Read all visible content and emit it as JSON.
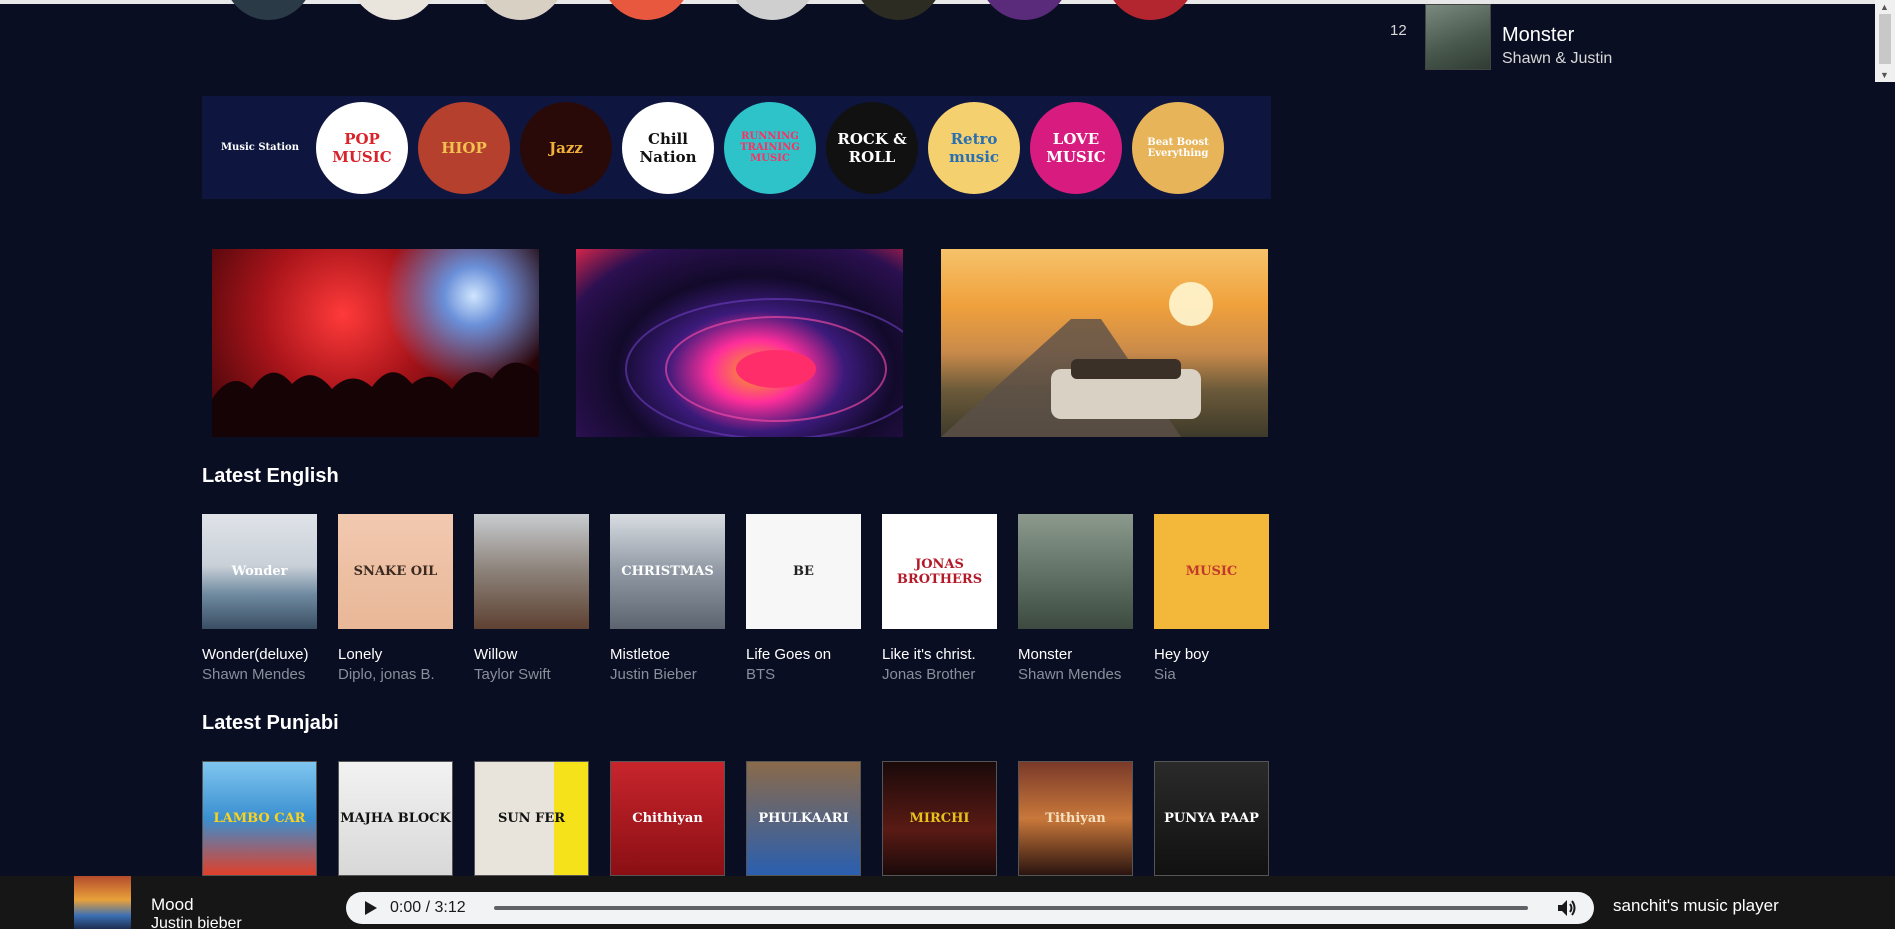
{
  "queue": {
    "number": "12",
    "title": "Monster",
    "artist": "Shawn & Justin"
  },
  "genres": [
    {
      "name": "Music Station",
      "bg": "#0e163f",
      "fg": "#ffffff"
    },
    {
      "name": "POP MUSIC",
      "bg": "#ffffff",
      "fg": "#d8232a"
    },
    {
      "name": "HIOP",
      "bg": "#b5402e",
      "fg": "#f2c14e"
    },
    {
      "name": "Jazz",
      "bg": "#2a0a08",
      "fg": "#f0b23a"
    },
    {
      "name": "Chill Nation",
      "bg": "#ffffff",
      "fg": "#111111"
    },
    {
      "name": "RUNNING TRAINING MUSIC",
      "bg": "#2ec3c8",
      "fg": "#ff2e63"
    },
    {
      "name": "ROCK & ROLL",
      "bg": "#111111",
      "fg": "#ffffff"
    },
    {
      "name": "Retro music",
      "bg": "#f4d06f",
      "fg": "#2a6fb0"
    },
    {
      "name": "LOVE MUSIC",
      "bg": "#d81b7f",
      "fg": "#ffffff"
    },
    {
      "name": "Beat Boost Everything",
      "bg": "#e7b45a",
      "fg": "#ffffff"
    }
  ],
  "sections": {
    "english": {
      "title": "Latest English",
      "items": [
        {
          "title": "Wonder(deluxe)",
          "artist": "Shawn Mendes",
          "art": "Wonder"
        },
        {
          "title": "Lonely",
          "artist": "Diplo, jonas B.",
          "art": "SNAKE OIL"
        },
        {
          "title": "Willow",
          "artist": "Taylor Swift",
          "art": ""
        },
        {
          "title": "Mistletoe",
          "artist": "Justin Bieber",
          "art": "CHRISTMAS"
        },
        {
          "title": "Life Goes on",
          "artist": "BTS",
          "art": "BE"
        },
        {
          "title": "Like it's christ.",
          "artist": "Jonas Brother",
          "art": "JONAS BROTHERS"
        },
        {
          "title": "Monster",
          "artist": "Shawn Mendes",
          "art": ""
        },
        {
          "title": "Hey boy",
          "artist": "Sia",
          "art": "MUSIC"
        }
      ]
    },
    "punjabi": {
      "title": "Latest Punjabi",
      "items": [
        {
          "art": "LAMBO CAR"
        },
        {
          "art": "MAJHA BLOCK"
        },
        {
          "art": "SUN FER"
        },
        {
          "art": "Chithiyan"
        },
        {
          "art": "PHULKAARI"
        },
        {
          "art": "MIRCHI"
        },
        {
          "art": "Tithiyan"
        },
        {
          "art": "PUNYA PAAP"
        }
      ]
    }
  },
  "player": {
    "now_title": "Mood",
    "now_artist": "Justin bieber",
    "time": "0:00 / 3:12",
    "progress": 0,
    "brand": "sanchit's music player"
  },
  "icons": {
    "play": "play-icon",
    "volume": "volume-icon"
  }
}
